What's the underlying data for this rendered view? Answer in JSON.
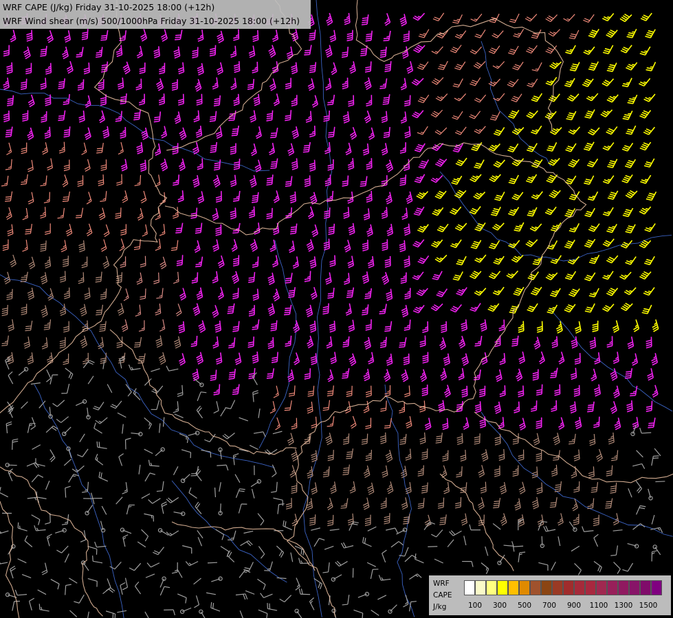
{
  "title": {
    "line1": "WRF CAPE (J/kg) Friday 31-10-2025 18:00 (+12h)",
    "line2": "WRF Wind shear (m/s) 500/1000hPa Friday 31-10-2025 18:00 (+12h)"
  },
  "legend": {
    "label1": "WRF",
    "label2": "CAPE",
    "label3": "J/kg",
    "colors": [
      "#ffffff",
      "#fafac8",
      "#ffff80",
      "#ffff00",
      "#ffbf00",
      "#e08a00",
      "#a0522d",
      "#8b4513",
      "#9a3a24",
      "#a02c2c",
      "#a52a3a",
      "#a8283f",
      "#a02850",
      "#98205a",
      "#901a60",
      "#881468",
      "#800c6a",
      "#800080"
    ],
    "ticks": [
      "100",
      "300",
      "500",
      "700",
      "900",
      "1100",
      "1300",
      "1500"
    ]
  },
  "barb_colors": {
    "grey": "#a0a0a0",
    "tan": "#b08a78",
    "rose": "#d78a84",
    "salmon": "#ef8a7a",
    "magenta": "#ee22ee",
    "yellow": "#ffff00"
  },
  "border_color": "#f4c8a8",
  "river_color": "#3b63c4"
}
